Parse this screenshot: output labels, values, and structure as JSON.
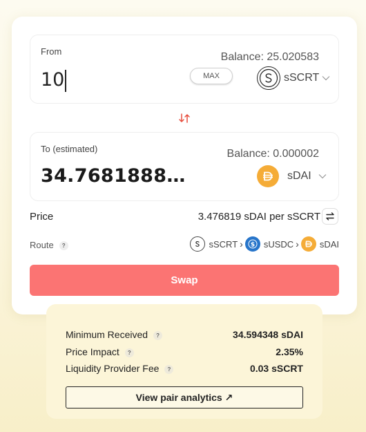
{
  "from": {
    "label": "From",
    "balance": "Balance: 25.020583",
    "amount": "10",
    "max_label": "MAX",
    "token": "sSCRT"
  },
  "to": {
    "label": "To (estimated)",
    "balance": "Balance: 0.000002",
    "amount": "34.7681888…",
    "token": "sDAI"
  },
  "price": {
    "label": "Price",
    "value": "3.476819 sDAI per sSCRT"
  },
  "route": {
    "label": "Route",
    "help": "?",
    "hops": [
      "sSCRT",
      "sUSDC",
      "sDAI"
    ],
    "separator": "›"
  },
  "swap_button": "Swap",
  "details": {
    "rows": [
      {
        "label": "Minimum Received",
        "help": "?",
        "value": "34.594348 sDAI"
      },
      {
        "label": "Price Impact",
        "help": "?",
        "value": "2.35%"
      },
      {
        "label": "Liquidity Provider Fee",
        "help": "?",
        "value": "0.03 sSCRT"
      }
    ],
    "analytics_link": "View pair analytics ↗"
  },
  "colors": {
    "swap_button": "#fb7473",
    "swap_arrows": "#e74c3c",
    "sdai": "#f5ac37",
    "susdc": "#2775ca",
    "sscrt": "#ffffff",
    "details_bg": "#fcf5d8"
  },
  "icons": {
    "from_token": "scrt-coin-icon",
    "to_token": "dai-coin-icon",
    "switch": "swap-vertical-arrows-icon",
    "price_toggle": "swap-horizontal-arrows-icon"
  }
}
